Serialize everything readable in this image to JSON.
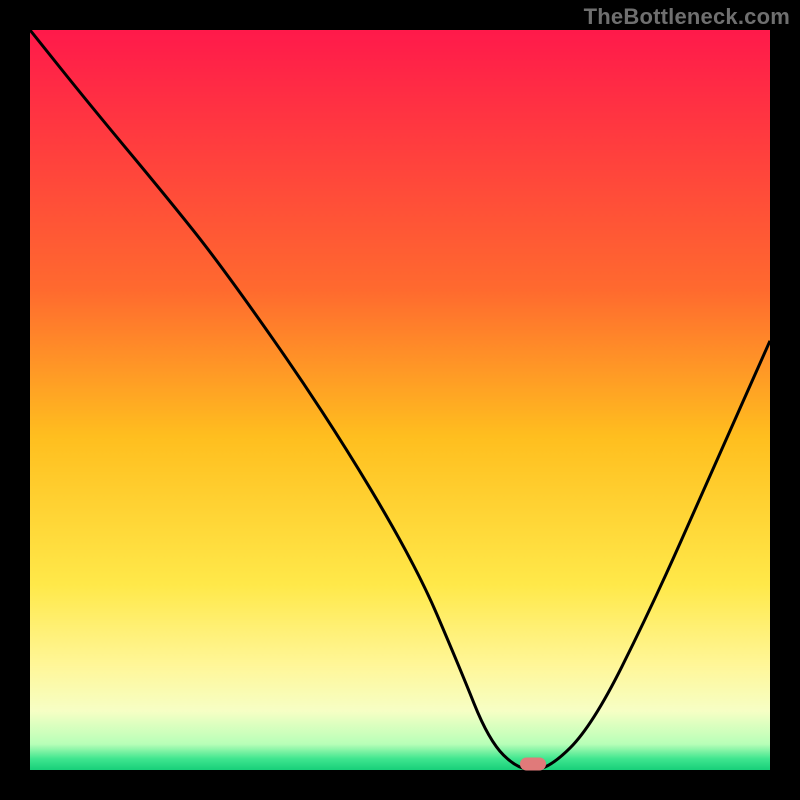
{
  "watermark": "TheBottleneck.com",
  "chart_data": {
    "type": "line",
    "title": "",
    "xlabel": "",
    "ylabel": "",
    "xlim": [
      0,
      100
    ],
    "ylim": [
      0,
      100
    ],
    "grid": false,
    "legend": false,
    "gradient": {
      "stops": [
        {
          "pos": 0.0,
          "color": "#ff1a4b"
        },
        {
          "pos": 0.35,
          "color": "#ff6a2f"
        },
        {
          "pos": 0.55,
          "color": "#ffbf1f"
        },
        {
          "pos": 0.75,
          "color": "#ffe94a"
        },
        {
          "pos": 0.86,
          "color": "#fff79a"
        },
        {
          "pos": 0.92,
          "color": "#f7ffc5"
        },
        {
          "pos": 0.965,
          "color": "#b8ffb8"
        },
        {
          "pos": 0.985,
          "color": "#3fe68f"
        },
        {
          "pos": 1.0,
          "color": "#18d07a"
        }
      ]
    },
    "series": [
      {
        "name": "bottleneck-curve",
        "color": "#000000",
        "x": [
          0,
          8,
          18,
          26,
          40,
          52,
          58,
          62,
          66,
          70,
          76,
          84,
          92,
          100
        ],
        "y": [
          100,
          90,
          78,
          68,
          48,
          28,
          14,
          4,
          0,
          0,
          6,
          22,
          40,
          58
        ]
      }
    ],
    "marker": {
      "x": 68,
      "y": 0.8,
      "color": "#e07a7a"
    }
  }
}
